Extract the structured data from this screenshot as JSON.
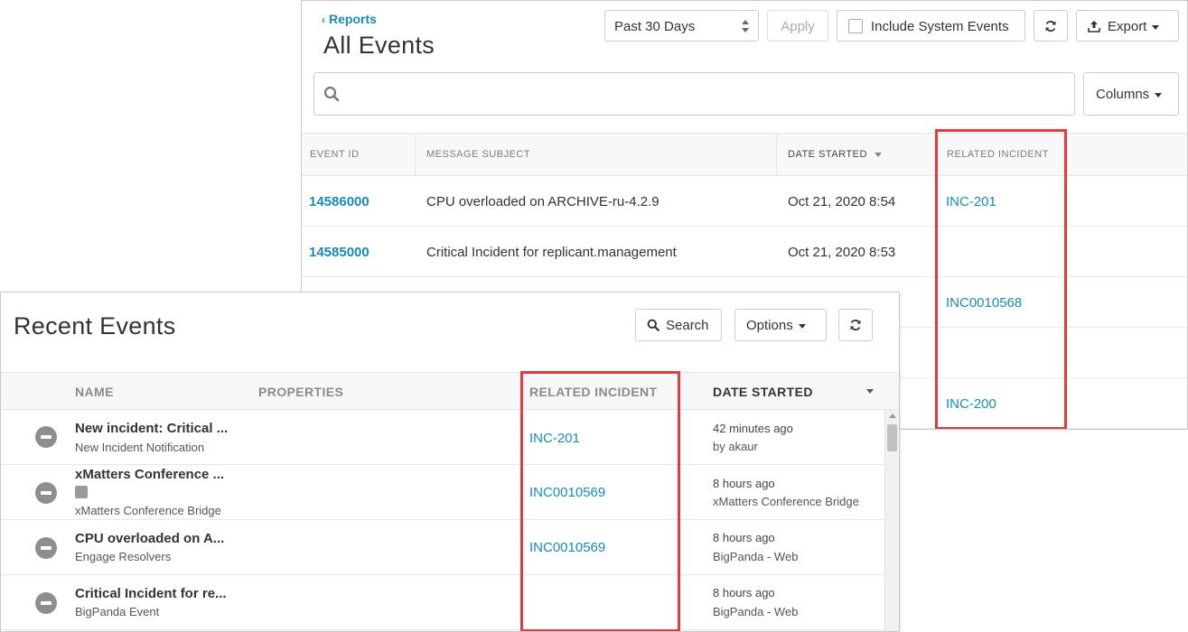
{
  "all_events": {
    "back_label": "Reports",
    "title": "All Events",
    "range_select": "Past 30 Days",
    "apply_label": "Apply",
    "system_events_label": "Include System Events",
    "export_label": "Export",
    "search_placeholder": "",
    "columns_label": "Columns",
    "headers": {
      "event_id": "EVENT ID",
      "message_subject": "MESSAGE SUBJECT",
      "date_started": "DATE STARTED",
      "related_incident": "RELATED INCIDENT"
    },
    "rows": [
      {
        "event_id": "14586000",
        "subject": "CPU overloaded on ARCHIVE-ru-4.2.9",
        "date": "Oct 21, 2020 8:54",
        "incident": "INC-201"
      },
      {
        "event_id": "14585000",
        "subject": "Critical Incident for replicant.management",
        "date": "Oct 21, 2020 8:53",
        "incident": ""
      },
      {
        "event_id": "",
        "subject": "",
        "date": "",
        "incident": "INC0010568"
      },
      {
        "event_id": "",
        "subject": "",
        "date": "",
        "incident": ""
      },
      {
        "event_id": "",
        "subject": "",
        "date": "",
        "incident": "INC-200"
      }
    ]
  },
  "recent_events": {
    "title": "Recent Events",
    "search_label": "Search",
    "options_label": "Options",
    "headers": {
      "name": "NAME",
      "properties": "PROPERTIES",
      "related_incident": "RELATED INCIDENT",
      "date_started": "DATE STARTED"
    },
    "rows": [
      {
        "name": "New incident: Critical ...",
        "subtitle": "New Incident Notification",
        "incident": "INC-201",
        "date": "42 minutes ago",
        "by": "by akaur"
      },
      {
        "name": "xMatters Conference ...",
        "subtitle": "xMatters Conference Bridge",
        "incident": "INC0010569",
        "date": "8 hours ago",
        "by": "xMatters Conference Bridge"
      },
      {
        "name": "CPU overloaded on A...",
        "subtitle": "Engage Resolvers",
        "incident": "INC0010569",
        "date": "8 hours ago",
        "by": "BigPanda - Web"
      },
      {
        "name": "Critical Incident for re...",
        "subtitle": "BigPanda Event",
        "incident": "",
        "date": "8 hours ago",
        "by": "BigPanda - Web"
      }
    ]
  },
  "colors": {
    "link": "#1a8ab5",
    "highlight": "#e53a3a",
    "status_icon": "#8e8e8e"
  },
  "icons": [
    "chevron-left-icon",
    "up-down-arrows-icon",
    "checkbox-icon",
    "refresh-icon",
    "upload-icon",
    "caret-down-icon",
    "search-icon",
    "minus-circle-icon",
    "phone-icon"
  ]
}
